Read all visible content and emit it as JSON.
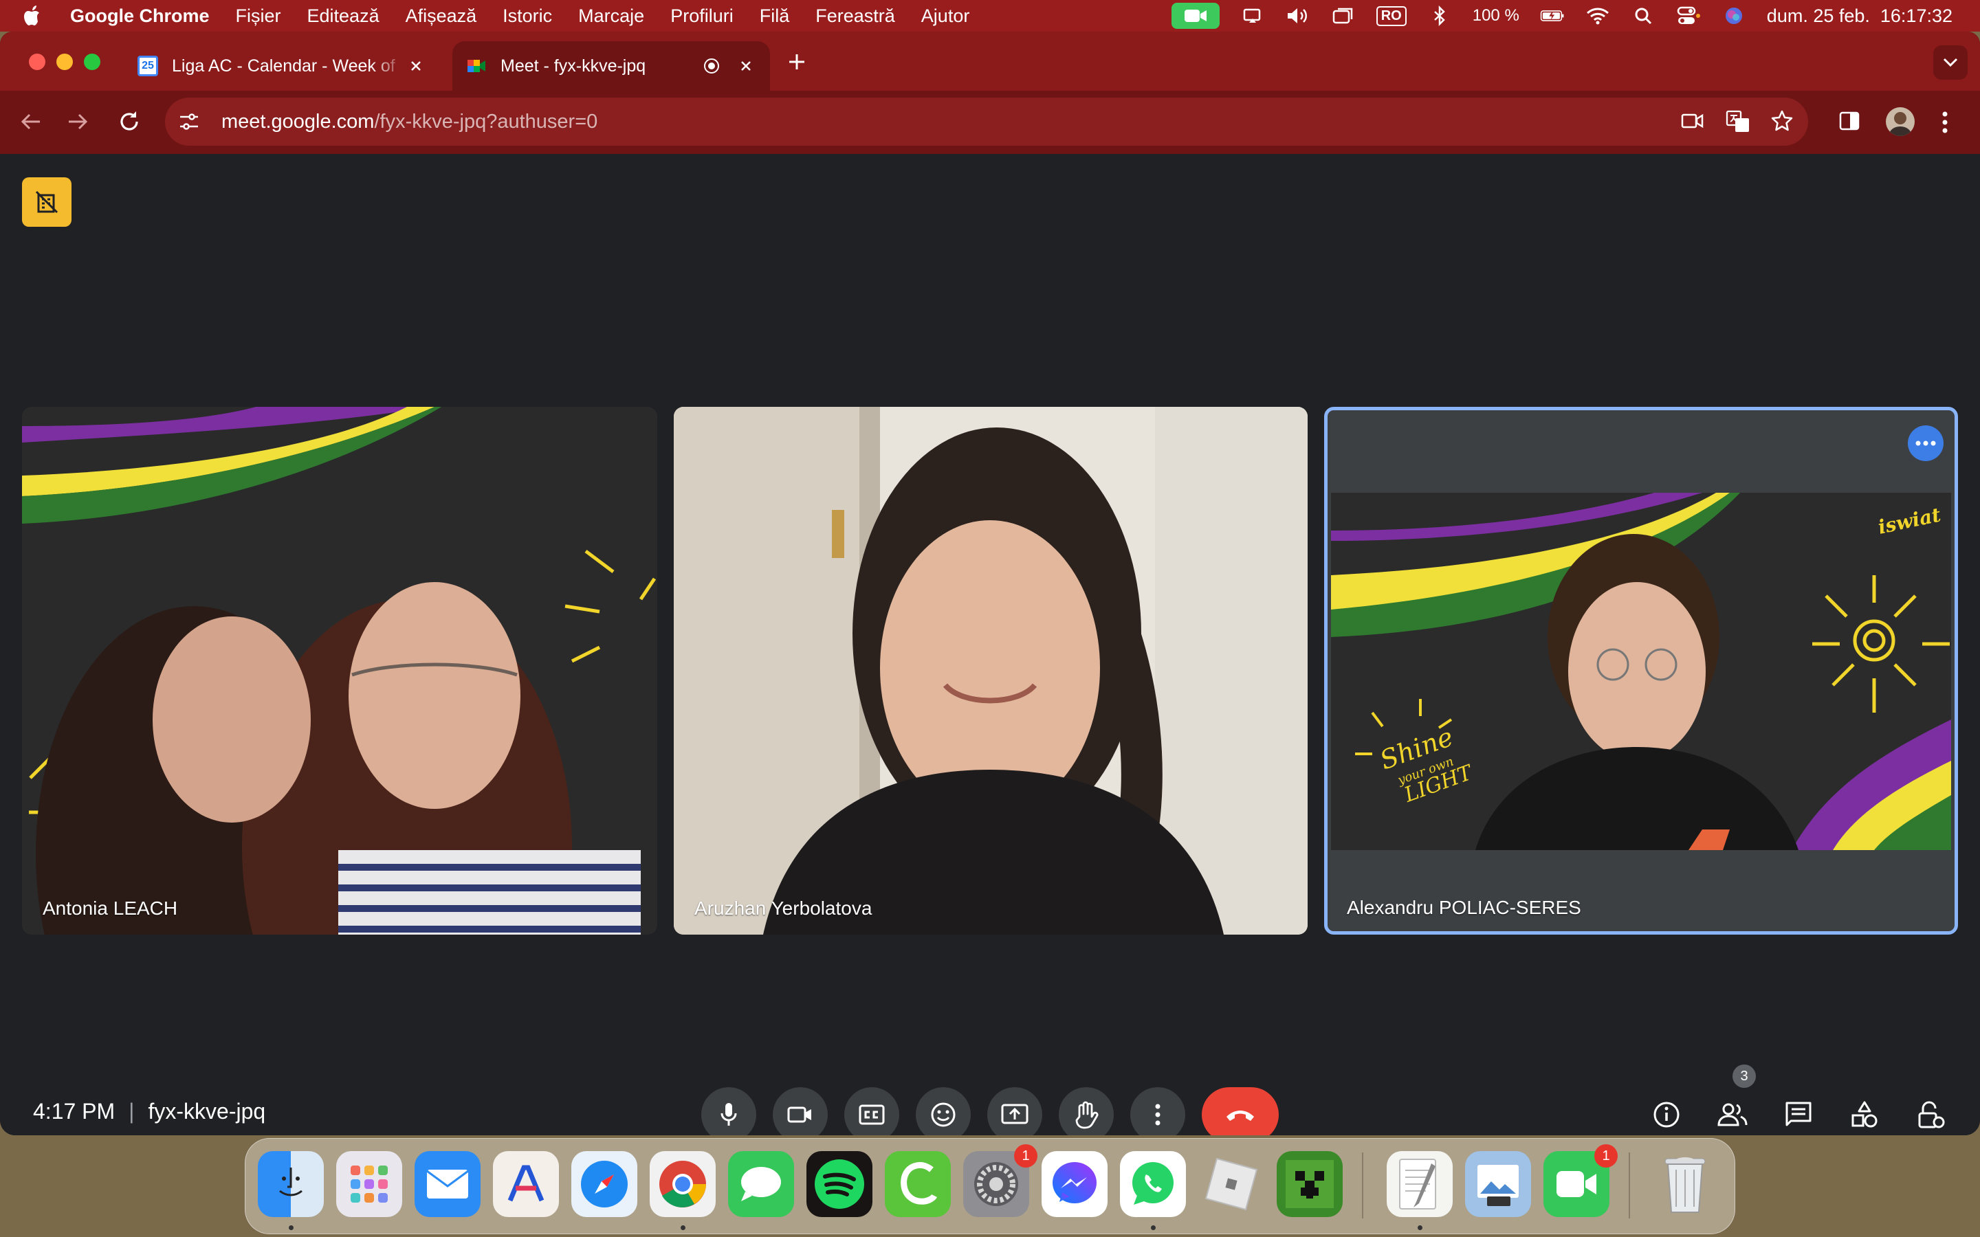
{
  "menubar": {
    "app": "Google Chrome",
    "items": [
      "Fișier",
      "Editează",
      "Afișează",
      "Istoric",
      "Marcaje",
      "Profiluri",
      "Filă",
      "Fereastră",
      "Ajutor"
    ],
    "keyboard": "RO",
    "battery": "100 %",
    "clock": "dum. 25 feb.  16:17:32"
  },
  "tabs": [
    {
      "title": "Liga AC - Calendar - Week of",
      "favicon": "calendar-icon",
      "date": "25"
    },
    {
      "title": "Meet - fyx-kkve-jpq",
      "favicon": "meet-icon"
    }
  ],
  "address": {
    "host": "meet.google.com",
    "path": "/fyx-kkve-jpq?authuser=0"
  },
  "participants": [
    {
      "name": "Antonia LEACH"
    },
    {
      "name": "Aruzhan Yerbolatova"
    },
    {
      "name": "Alexandru POLIAC-SERES"
    }
  ],
  "background_text": {
    "line1": "Shine",
    "line2": "your own",
    "line3": "LIGHT",
    "brand": "iswiat"
  },
  "footer": {
    "time": "4:17 PM",
    "separator": "|",
    "meeting_code": "fyx-kkve-jpq",
    "people_count": "3"
  },
  "dock": {
    "system_settings_badge": "1",
    "facetime_badge": "1"
  },
  "colors": {
    "menubar": "#9a1d1d",
    "tabbar": "#8b1a1a",
    "meet_bg": "#202124",
    "end_call": "#ea4335",
    "active_speaker": "#8ab4f8"
  }
}
